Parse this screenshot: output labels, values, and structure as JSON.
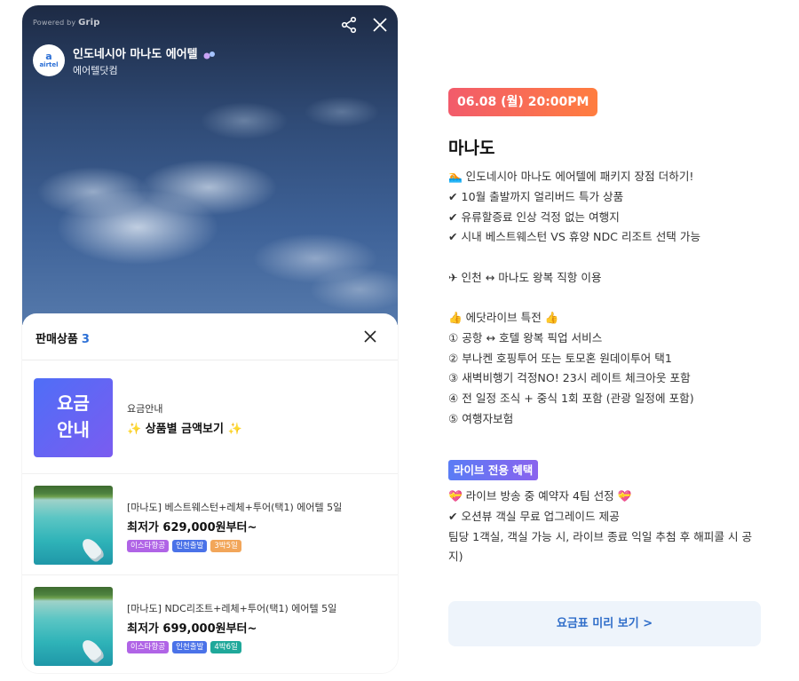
{
  "live": {
    "powered_by": "Powered by",
    "powered_brand": "Grip",
    "title": "인도네시아 마나도 에어텔",
    "channel": "에어텔닷컴",
    "avatar_mark": "a",
    "avatar_text": "airtel",
    "share_icon": "share-icon",
    "close_icon": "close-icon"
  },
  "sheet": {
    "heading": "판매상품",
    "count": "3",
    "close_icon": "close-icon",
    "items": [
      {
        "thumb_line1": "요금",
        "thumb_line2": "안내",
        "sub": "요금안내",
        "main": "✨ 상품별 금액보기 ✨",
        "tags": []
      },
      {
        "sub": "[마나도] 베스트웨스턴+레체+투어(택1) 에어텔 5일",
        "main": "최저가 629,000원부터~",
        "tags": [
          {
            "label": "이스타항공",
            "color": "#b064e6"
          },
          {
            "label": "인천출발",
            "color": "#4a72e8"
          },
          {
            "label": "3박5일",
            "color": "#f2a65a"
          }
        ]
      },
      {
        "sub": "[마나도] NDC리조트+레체+투어(택1) 에어텔 5일",
        "main": "최저가 699,000원부터~",
        "tags": [
          {
            "label": "이스타항공",
            "color": "#b064e6"
          },
          {
            "label": "인천출발",
            "color": "#4a72e8"
          },
          {
            "label": "4박6일",
            "color": "#1fa89a"
          }
        ]
      }
    ]
  },
  "info": {
    "date": "06.08 (월) 20:00PM",
    "title": "마나도",
    "lines_block1": [
      "🏊 인도네시아 마나도 에어텔에 패키지 장점 더하기!",
      "✔ 10월 출발까지 얼리버드 특가 상품",
      "✔ 유류할증료 인상 걱정 없는 여행지",
      "✔ 시내 베스트웨스턴 VS 휴양 NDC 리조트 선택 가능"
    ],
    "line_flight": "✈ 인천 ↔ 마나도 왕복 직항 이용",
    "lines_block3": [
      "👍 에닷라이브 특전 👍",
      "① 공항 ↔ 호텔 왕복 픽업 서비스",
      "② 부나켄 호핑투어 또는 토모혼 원데이투어 택1",
      "③ 새벽비행기 걱정NO! 23시 레이트 체크아웃 포함",
      "④ 전 일정 조식 + 중식 1회 포함 (관광 일정에 포함)",
      "⑤ 여행자보험"
    ],
    "benefit_badge": "라이브 전용 혜택",
    "lines_block4": [
      "💝 라이브 방송 중 예약자 4팀 선정 💝",
      "✔ 오션뷰 객실 무료 업그레이드 제공",
      "팀당 1객실, 객실 가능 시, 라이브 종료 익일 추첨 후 해피콜 시 공지)"
    ],
    "preview_button": "요금표 미리 보기 >"
  },
  "colors": {
    "accent_blue": "#2b6fd6",
    "date_badge_start": "#f25b6b",
    "date_badge_end": "#ff7d3f",
    "benefit_badge_start": "#5a7cf5",
    "benefit_badge_end": "#8a63ee"
  }
}
